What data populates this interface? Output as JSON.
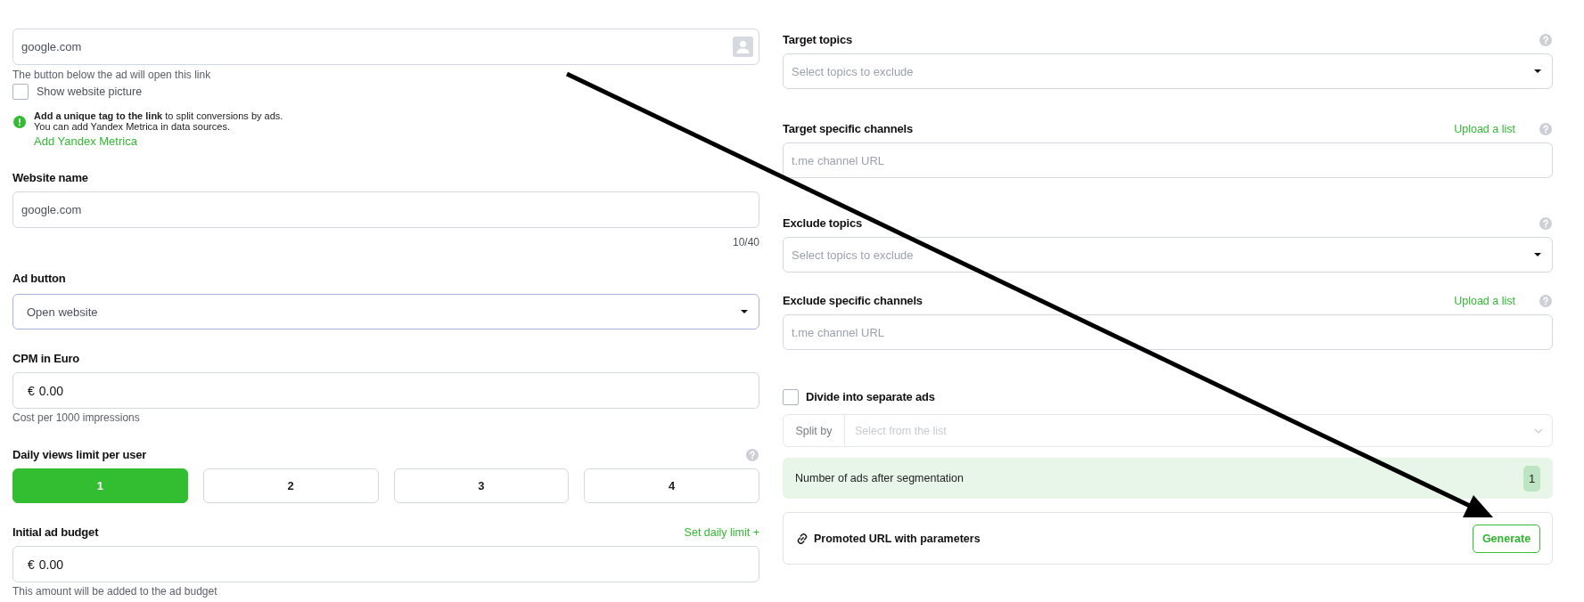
{
  "link": {
    "value": "google.com",
    "helper": "The button below the ad will open this link"
  },
  "show_picture": {
    "label": "Show website picture",
    "checked": false
  },
  "notice": {
    "lines": [
      "**Add a unique tag to the link** to split conversions by ads.",
      "You can add Yandex Metrica in data sources."
    ],
    "link": "Add Yandex Metrica"
  },
  "website_name": {
    "label": "Website name",
    "value": "google.com",
    "counter": "10/40"
  },
  "ad_button": {
    "label": "Ad button",
    "value": "Open website",
    "focused": true
  },
  "cpm": {
    "label": "CPM in Euro",
    "currency": "€",
    "value": "0.00",
    "helper": "Cost per 1000 impressions"
  },
  "daily_views": {
    "label": "Daily views limit per user",
    "help": true,
    "options": [
      {
        "label": "1",
        "selected": true
      },
      {
        "label": "2",
        "selected": false
      },
      {
        "label": "3",
        "selected": false
      },
      {
        "label": "4",
        "selected": false
      }
    ]
  },
  "budget": {
    "label": "Initial ad budget",
    "action": "Set daily limit +",
    "currency": "€",
    "value": "0.00",
    "helper": "This amount will be added to the ad budget"
  },
  "targeting": [
    {
      "kind": "select",
      "label": "Target topics",
      "help": true,
      "placeholder": "Select topics to exclude"
    },
    {
      "kind": "input",
      "label": "Target specific channels",
      "action": "Upload a list",
      "help": true,
      "placeholder": "t.me channel URL"
    },
    {
      "kind": "select",
      "label": "Exclude topics",
      "help": true,
      "placeholder": "Select topics to exclude"
    },
    {
      "kind": "input",
      "label": "Exclude specific channels",
      "action": "Upload a list",
      "help": true,
      "placeholder": "t.me channel URL"
    }
  ],
  "divide": {
    "label": "Divide into separate ads",
    "checked": false
  },
  "split_by": {
    "label": "Split by",
    "placeholder": "Select from the list",
    "disabled": true
  },
  "segmentation": {
    "label": "Number of ads after segmentation",
    "count": "1"
  },
  "promoted_url": {
    "label": "Promoted URL with parameters",
    "button": "Generate"
  }
}
